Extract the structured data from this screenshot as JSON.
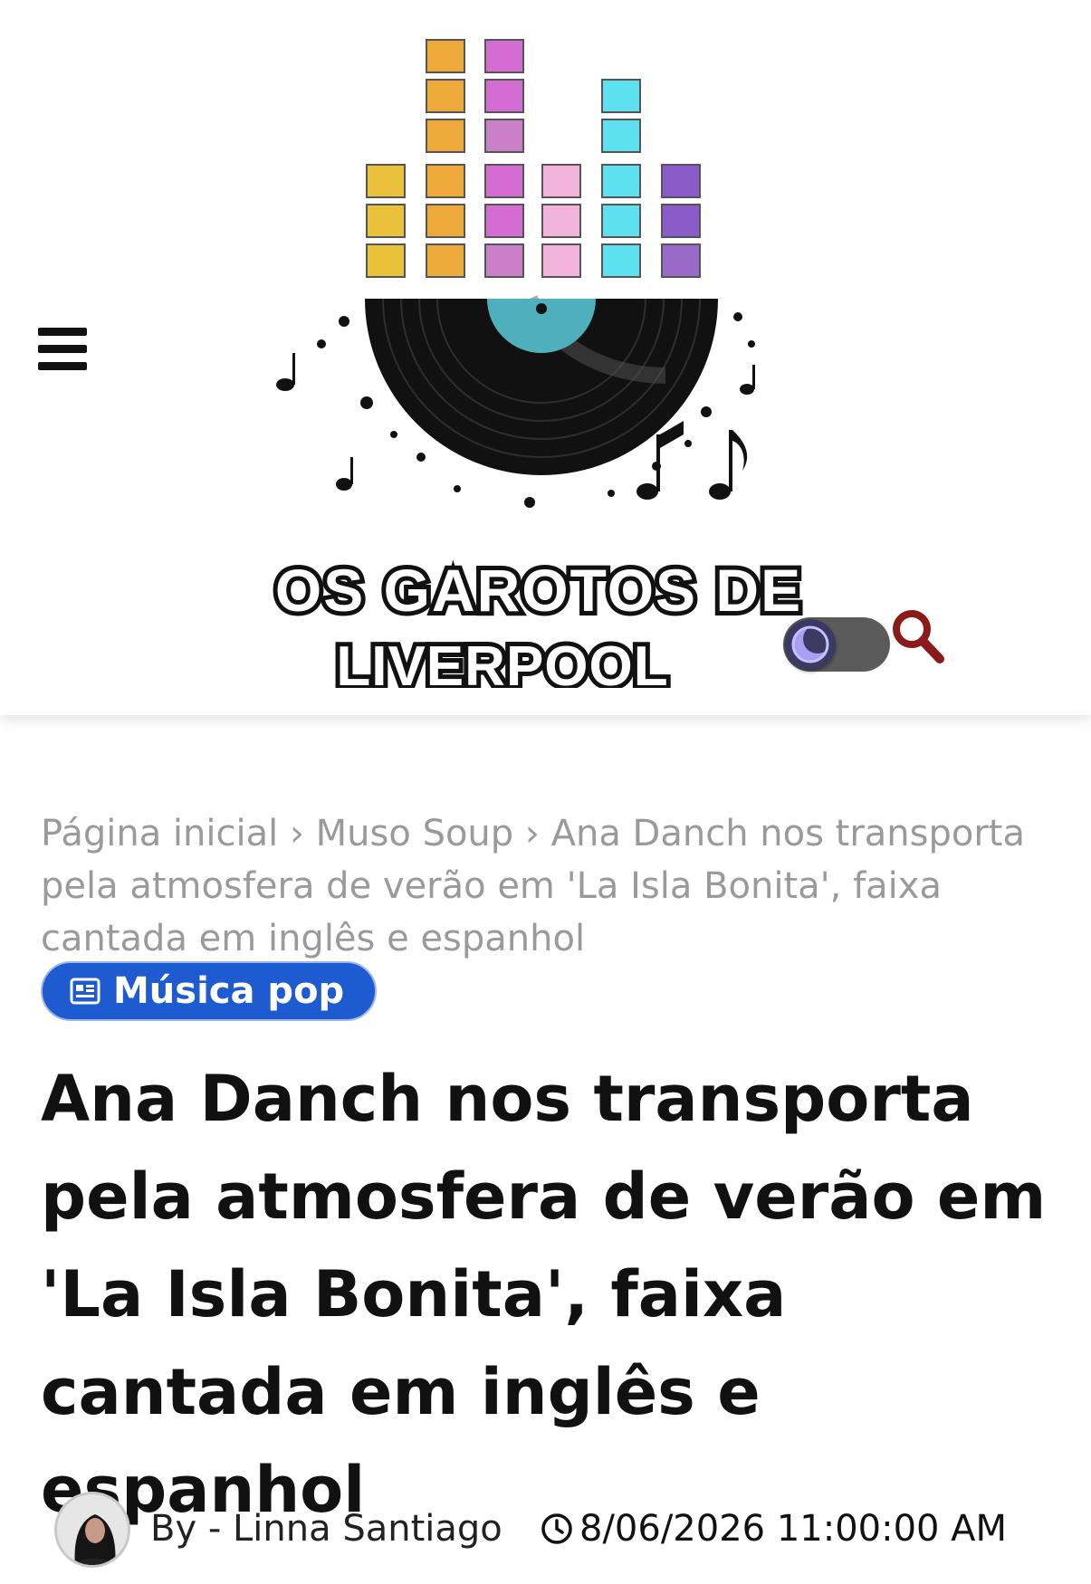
{
  "header": {
    "logo": {
      "line1": "OS GAROTOS DE",
      "line2": "LIVERPOOL",
      "icon": "vinyl-record-equalizer-logo"
    },
    "menu_icon": "hamburger-menu-icon",
    "theme_toggle_icon": "moon-icon",
    "search_icon": "search-icon",
    "accent_color": "#8b1a1a"
  },
  "breadcrumb": {
    "items": [
      "Página inicial",
      "Muso Soup",
      "Ana Danch nos transporta pela atmosfera de verão em 'La Isla Bonita', faixa cantada em inglês e espanhol"
    ],
    "separator": "›"
  },
  "category": {
    "label": "Música pop",
    "icon": "newspaper-icon",
    "color": "#1e5bd0"
  },
  "article": {
    "title": "Ana Danch nos transporta pela atmosfera de verão em 'La Isla Bonita', faixa cantada em inglês e espanhol"
  },
  "meta": {
    "by_label": "By -",
    "author": "Linna Santiago",
    "date_icon": "clock-icon",
    "datetime": "8/06/2026 11:00:00 AM"
  }
}
